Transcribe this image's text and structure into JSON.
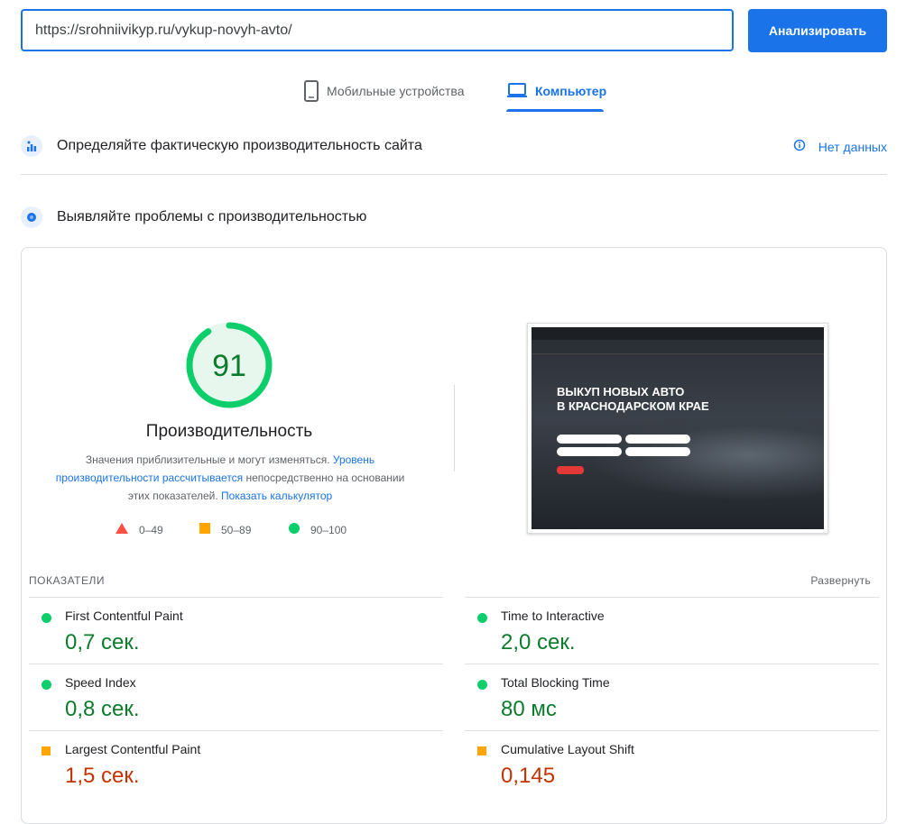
{
  "search": {
    "url": "https://srohniivikyp.ru/vykup-novyh-avto/",
    "button_label": "Анализировать"
  },
  "tabs": [
    {
      "label": "Мобильные устройства",
      "icon": "phone-icon",
      "active": false
    },
    {
      "label": "Компьютер",
      "icon": "laptop-icon",
      "active": true
    }
  ],
  "field_data": {
    "title": "Определяйте фактическую производительность сайта",
    "status": "Нет данных"
  },
  "lab": {
    "title": "Выявляйте проблемы с производительностью",
    "score": "91",
    "score_fraction": 0.91,
    "category": "Производительность",
    "desc_1": "Значения приблизительные и могут изменяться. ",
    "desc_link_1": "Уровень производительности рассчитывается",
    "desc_2": " непосредственно на основании этих показателей. ",
    "desc_link_2": "Показать калькулятор",
    "legend": [
      {
        "range": "0–49",
        "shape": "triangle",
        "color": "#ff4e42"
      },
      {
        "range": "50–89",
        "shape": "square",
        "color": "#ffa400"
      },
      {
        "range": "90–100",
        "shape": "circle",
        "color": "#0cce6b"
      }
    ],
    "screenshot": {
      "headline_1": "ВЫКУП НОВЫХ АВТО",
      "headline_2": "В КРАСНОДАРСКОМ КРАЕ"
    }
  },
  "metrics": {
    "header": "ПОКАЗАТЕЛИ",
    "expand": "Развернуть",
    "items": [
      {
        "label": "First Contentful Paint",
        "value": "0,7 сек.",
        "status": "good"
      },
      {
        "label": "Time to Interactive",
        "value": "2,0 сек.",
        "status": "good"
      },
      {
        "label": "Speed Index",
        "value": "0,8 сек.",
        "status": "good"
      },
      {
        "label": "Total Blocking Time",
        "value": "80 мс",
        "status": "good"
      },
      {
        "label": "Largest Contentful Paint",
        "value": "1,5 сек.",
        "status": "average"
      },
      {
        "label": "Cumulative Layout Shift",
        "value": "0,145",
        "status": "average"
      }
    ]
  }
}
